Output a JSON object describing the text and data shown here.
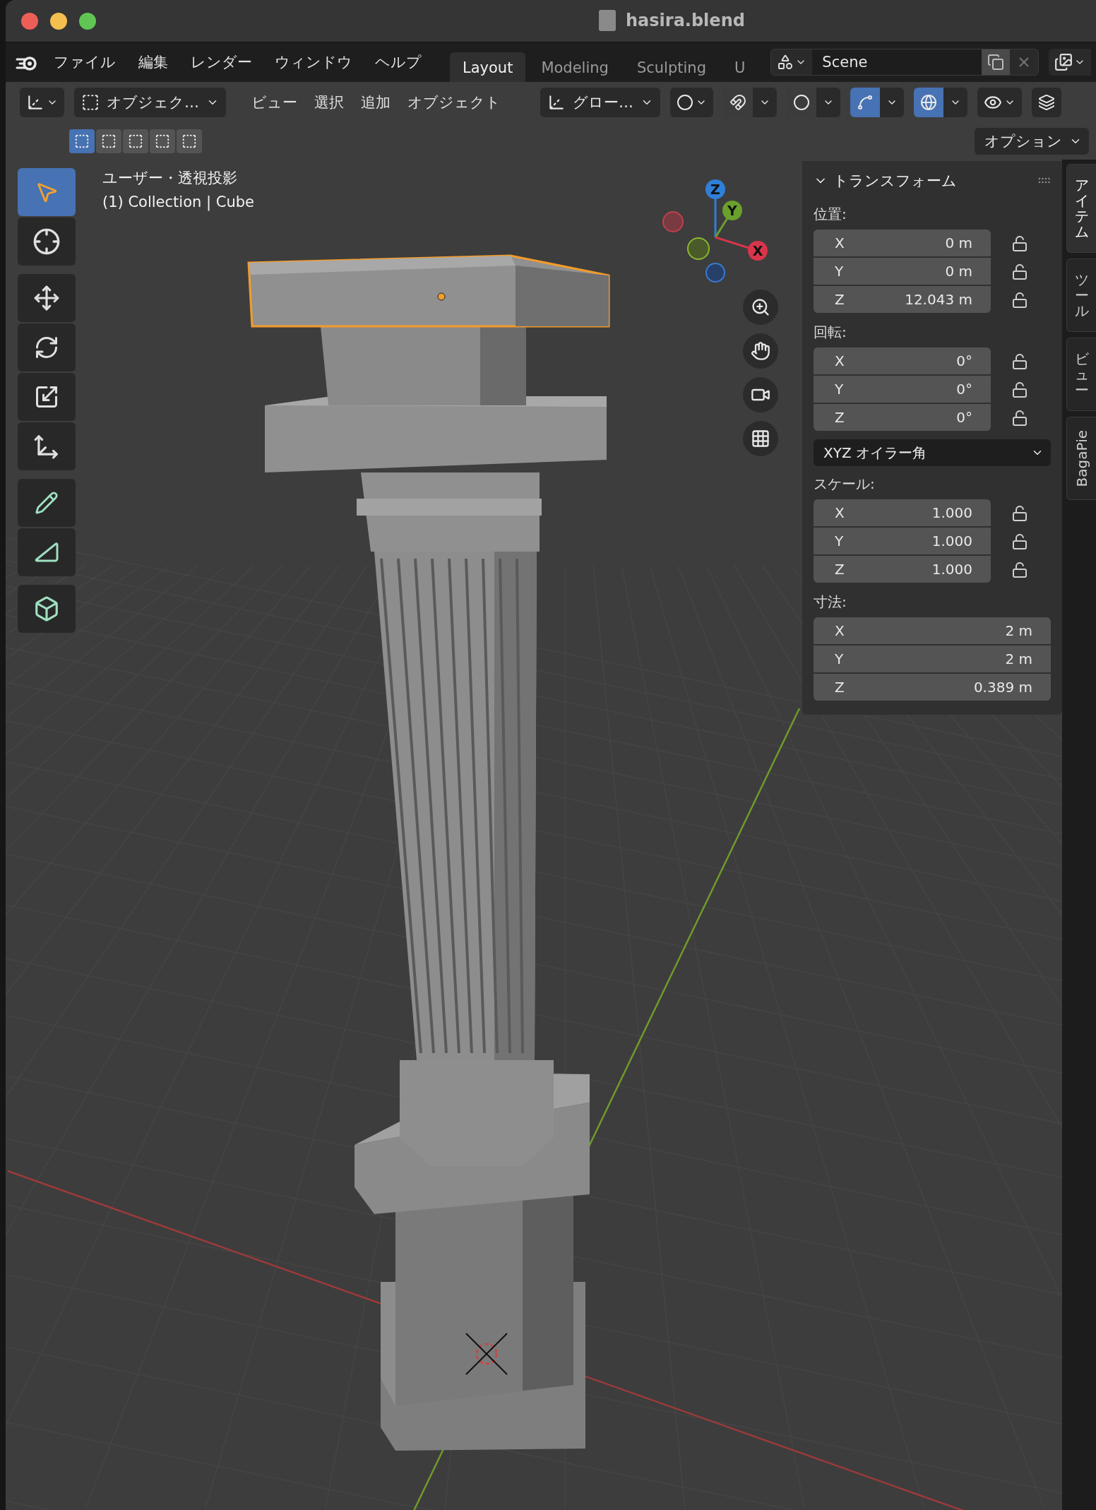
{
  "window": {
    "title": "hasira.blend"
  },
  "menu": [
    "ファイル",
    "編集",
    "レンダー",
    "ウィンドウ",
    "ヘルプ"
  ],
  "workspaces": [
    {
      "label": "Layout",
      "selected": true
    },
    {
      "label": "Modeling",
      "selected": false
    },
    {
      "label": "Sculpting",
      "selected": false
    },
    {
      "label": "U",
      "selected": false
    }
  ],
  "scene": {
    "value": "Scene"
  },
  "header": {
    "mode": "オブジェク…",
    "menus": [
      "ビュー",
      "選択",
      "追加",
      "オブジェクト"
    ],
    "orientation": "グロー…",
    "toggles": [
      {
        "kind": "snap",
        "on": false
      },
      {
        "kind": "proportional",
        "on": false
      },
      {
        "kind": "gizmo",
        "on": true
      },
      {
        "kind": "overlay",
        "on": true
      }
    ]
  },
  "select_modes": [
    {
      "selected": true
    },
    {
      "selected": false
    },
    {
      "selected": false
    },
    {
      "selected": false
    },
    {
      "selected": false
    }
  ],
  "options": "オプション",
  "tools": [
    {
      "kind": "select",
      "selected": true
    },
    {
      "kind": "cursor",
      "selected": false
    },
    {
      "kind": "move",
      "selected": false
    },
    {
      "kind": "rotate",
      "selected": false
    },
    {
      "kind": "scale",
      "selected": false
    },
    {
      "kind": "transform",
      "selected": false
    },
    {
      "kind": "annotate",
      "selected": false
    },
    {
      "kind": "measure",
      "selected": false
    },
    {
      "kind": "add_cube",
      "selected": false
    }
  ],
  "viewport": {
    "view_name": "ユーザー・透視投影",
    "object_info": "(1) Collection | Cube",
    "gizmo_axes": [
      "X",
      "Y",
      "Z"
    ]
  },
  "transform": {
    "title": "トランスフォーム",
    "groups": [
      {
        "label": "位置:",
        "rows": [
          {
            "axis": "X",
            "value": "0 m",
            "locked": false
          },
          {
            "axis": "Y",
            "value": "0 m",
            "locked": false
          },
          {
            "axis": "Z",
            "value": "12.043 m",
            "locked": false
          }
        ]
      },
      {
        "label": "回転:",
        "rows": [
          {
            "axis": "X",
            "value": "0°",
            "locked": false
          },
          {
            "axis": "Y",
            "value": "0°",
            "locked": false
          },
          {
            "axis": "Z",
            "value": "0°",
            "locked": false
          }
        ],
        "dropdown": "XYZ オイラー角"
      },
      {
        "label": "スケール:",
        "rows": [
          {
            "axis": "X",
            "value": "1.000",
            "locked": false
          },
          {
            "axis": "Y",
            "value": "1.000",
            "locked": false
          },
          {
            "axis": "Z",
            "value": "1.000",
            "locked": false
          }
        ]
      },
      {
        "label": "寸法:",
        "rows": [
          {
            "axis": "X",
            "value": "2 m"
          },
          {
            "axis": "Y",
            "value": "2 m"
          },
          {
            "axis": "Z",
            "value": "0.389 m"
          }
        ]
      }
    ]
  },
  "sidebar_tabs": [
    {
      "label": "アイテム",
      "selected": true,
      "kind": "cjk"
    },
    {
      "label": "ツール",
      "selected": false,
      "kind": "cjk"
    },
    {
      "label": "ビュー",
      "selected": false,
      "kind": "cjk"
    },
    {
      "label": "BagaPie",
      "selected": false,
      "kind": "latin"
    }
  ]
}
